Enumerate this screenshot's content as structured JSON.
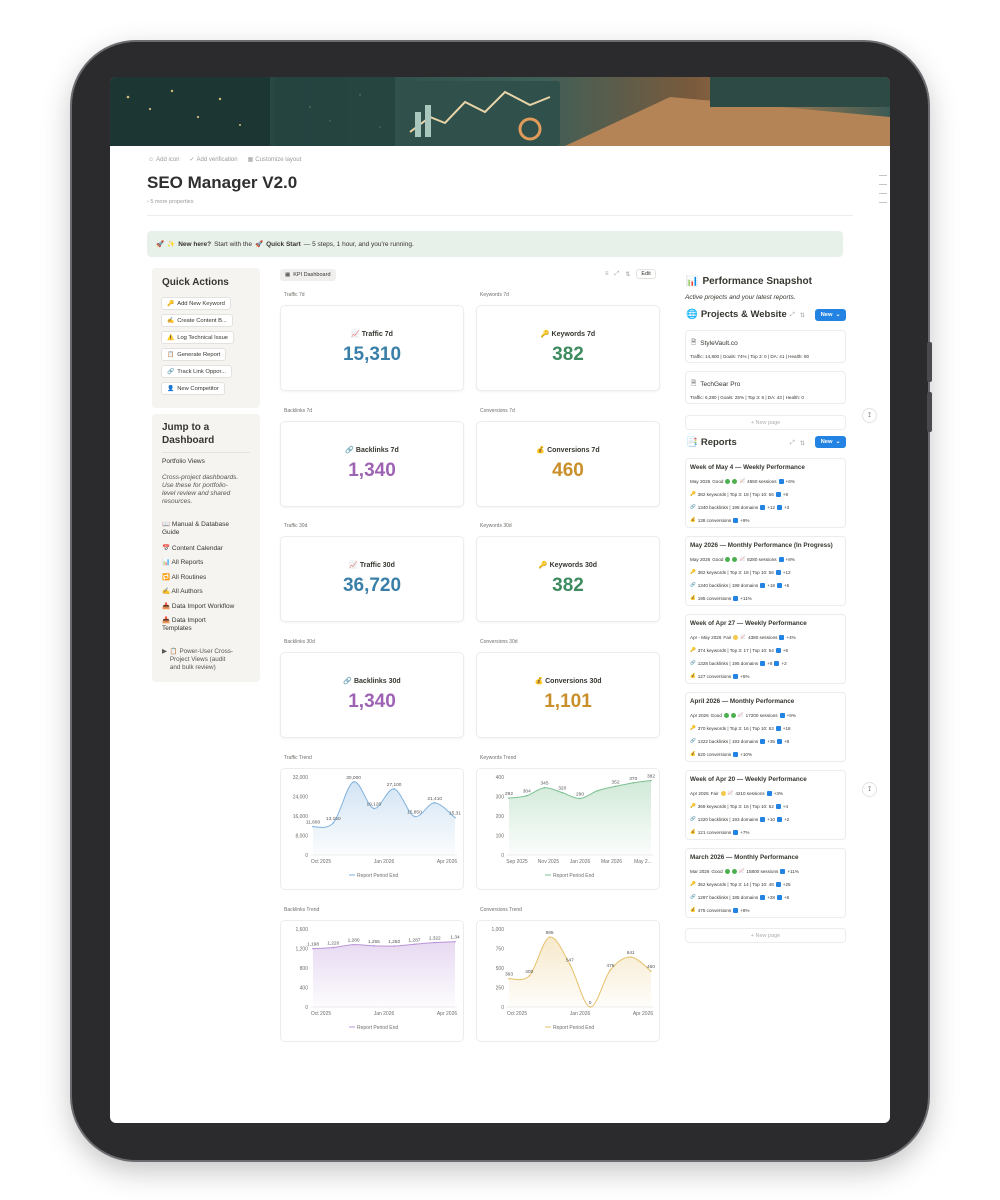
{
  "page": {
    "meta_actions": [
      "Add icon",
      "Add verification",
      "Customize layout"
    ],
    "title": "SEO Manager V2.0",
    "more_properties": "5 more properties"
  },
  "callout": {
    "icon": "🚀",
    "prefix_icon": "✨",
    "bold_intro": "New here?",
    "text_a": "Start with the",
    "qs_icon": "🚀",
    "qs_label": "Quick Start",
    "text_b": "— 5 steps, 1 hour, and you're running."
  },
  "quick_actions": {
    "title": "Quick Actions",
    "items": [
      {
        "icon": "🔑",
        "label": "Add New Keyword"
      },
      {
        "icon": "✍️",
        "label": "Create Content B..."
      },
      {
        "icon": "⚠️",
        "label": "Log Technical Issue"
      },
      {
        "icon": "📋",
        "label": "Generate Report"
      },
      {
        "icon": "🔗",
        "label": "Track Link Oppor..."
      },
      {
        "icon": "👤",
        "label": "New Competitor"
      }
    ]
  },
  "jump": {
    "title_line1": "Jump to a",
    "title_line2": "Dashboard",
    "section": "Portfolio Views",
    "description": [
      "Cross-project dashboards.",
      "Use these for portfolio-",
      "level review and shared",
      "resources."
    ],
    "links": [
      {
        "icon": "📖",
        "label": "Manual & Database",
        "label2": "Guide"
      },
      {
        "icon": "📅",
        "label": "Content Calendar"
      },
      {
        "icon": "📊",
        "label": "All Reports"
      },
      {
        "icon": "🔁",
        "label": "All Routines"
      },
      {
        "icon": "✍️",
        "label": "All Authors"
      },
      {
        "icon": "📥",
        "label": "Data Import Workflow"
      },
      {
        "icon": "📥",
        "label": "Data Import",
        "label2": "Templates"
      }
    ],
    "toggle": {
      "icon": "📋",
      "line1": "Power-User Cross-",
      "line2": "Project Views (audit",
      "line3": "and bulk review)"
    }
  },
  "kpi": {
    "tab_label": "KPI Dashboard",
    "edit_label": "Edit",
    "cards": [
      {
        "label": "Traffic 7d",
        "icon": "📈",
        "title": "Traffic 7d",
        "value": "15,310",
        "color": "#3a7fa8"
      },
      {
        "label": "Keywords 7d",
        "icon": "🔑",
        "title": "Keywords 7d",
        "value": "382",
        "color": "#3e8b5f"
      },
      {
        "label": "Backlinks 7d",
        "icon": "🔗",
        "title": "Backlinks 7d",
        "value": "1,340",
        "color": "#9d62b3"
      },
      {
        "label": "Conversions 7d",
        "icon": "💰",
        "title": "Conversions 7d",
        "value": "460",
        "color": "#c98f2a"
      },
      {
        "label": "Traffic 30d",
        "icon": "📈",
        "title": "Traffic 30d",
        "value": "36,720",
        "color": "#3a7fa8"
      },
      {
        "label": "Keywords 30d",
        "icon": "🔑",
        "title": "Keywords 30d",
        "value": "382",
        "color": "#3e8b5f"
      },
      {
        "label": "Backlinks 30d",
        "icon": "🔗",
        "title": "Backlinks 30d",
        "value": "1,340",
        "color": "#9d62b3"
      },
      {
        "label": "Conversions 30d",
        "icon": "💰",
        "title": "Conversions 30d",
        "value": "1,101",
        "color": "#c98f2a"
      }
    ]
  },
  "chart_data": [
    {
      "type": "area",
      "label": "Traffic Trend",
      "color": "#7fb2de",
      "legend": "Report Period End",
      "yticks": [
        "32,000",
        "24,000",
        "16,000",
        "8,000",
        "0"
      ],
      "ylim": [
        0,
        32000
      ],
      "xticks": [
        "Oct 2025",
        "Jan 2026",
        "Apr 2026"
      ],
      "values": [
        11600,
        13150,
        30000,
        19120,
        27100,
        15850,
        21410,
        15310
      ],
      "point_labels": [
        "11,600",
        "13,150",
        "30,000",
        "19,120",
        "27,100",
        "15,850",
        "21,410",
        "15,31"
      ]
    },
    {
      "type": "area",
      "label": "Keywords Trend",
      "color": "#7cc191",
      "legend": "Report Period End",
      "yticks": [
        "400",
        "300",
        "200",
        "100",
        "0"
      ],
      "ylim": [
        0,
        400
      ],
      "xticks": [
        "Sep 2025",
        "Nov 2025",
        "Jan 2026",
        "Mar 2026",
        "May 2..."
      ],
      "values": [
        292,
        304,
        345,
        320,
        290,
        330,
        352,
        370,
        382
      ],
      "point_labels": [
        "292",
        "304",
        "345",
        "320",
        "290",
        "",
        "352",
        "370",
        "382"
      ]
    },
    {
      "type": "area",
      "label": "Backlinks Trend",
      "color": "#bb94d8",
      "legend": "Report Period End",
      "yticks": [
        "1,600",
        "1,200",
        "800",
        "400",
        "0"
      ],
      "ylim": [
        0,
        1600
      ],
      "xticks": [
        "Oct 2025",
        "Jan 2026",
        "Apr 2026"
      ],
      "values": [
        1198,
        1220,
        1280,
        1255,
        1250,
        1287,
        1322,
        1340
      ],
      "point_labels": [
        "1,198",
        "1,220",
        "1,280",
        "1,255",
        "1,250",
        "1,287",
        "1,322",
        "1,34"
      ]
    },
    {
      "type": "area",
      "label": "Conversions Trend",
      "color": "#e6c06a",
      "legend": "Report Period End",
      "yticks": [
        "1,000",
        "750",
        "500",
        "250",
        "0"
      ],
      "ylim": [
        0,
        1000
      ],
      "xticks": [
        "Oct 2025",
        "Jan 2026",
        "Apr 2026"
      ],
      "values": [
        363,
        400,
        895,
        547,
        0,
        475,
        641,
        460
      ],
      "point_labels": [
        "363",
        "400",
        "895",
        "547",
        "0",
        "475",
        "641",
        "460"
      ]
    }
  ],
  "snapshot": {
    "title": "Performance Snapshot",
    "subtitle": "Active projects and your latest reports.",
    "projects_title": "Projects & Website",
    "new_label": "New",
    "new_page_label": "+ New page",
    "projects": [
      {
        "name": "StyleVault.co",
        "detail": "Traffic: 14,800 | Goals: 74% | Top 3: 0 | DA: 41 | Health: 80"
      },
      {
        "name": "TechGear Pro",
        "detail": "Traffic: 6,280 | Goals: 25% | Top 3: 6 | DA: 43 | Health: 0"
      }
    ],
    "reports_title": "Reports",
    "reports": [
      {
        "title": "Week of May 4 — Weekly Performance",
        "period": "May 2026",
        "health": "Good",
        "dots": [
          "#4caf50",
          "#4caf50"
        ],
        "sessions": "4650 sessions",
        "s_delta": "+6%",
        "kw": "382 keywords | Top 3: 18 | Top 10: 56",
        "kw_delta": "+8",
        "bl": "1340 backlinks | 198 domains",
        "bl_d1": "+12",
        "bl_d2": "+3",
        "conv": "138 conversions",
        "conv_delta": "+9%"
      },
      {
        "title": "May 2026 — Monthly Performance (In Progress)",
        "period": "May 2026",
        "health": "Good",
        "dots": [
          "#4caf50",
          "#4caf50"
        ],
        "sessions": "8280 sessions",
        "s_delta": "+8%",
        "kw": "382 keywords | Top 3: 18 | Top 10: 56",
        "kw_delta": "+12",
        "bl": "1340 backlinks | 198 domains",
        "bl_d1": "+18",
        "bl_d2": "+5",
        "conv": "195 conversions",
        "conv_delta": "+11%"
      },
      {
        "title": "Week of Apr 27 — Weekly Performance",
        "period": "Apr - May 2026",
        "health": "Fair",
        "dots": [
          "#f2c94c"
        ],
        "sessions": "4380 sessions",
        "s_delta": "+4%",
        "kw": "374 keywords | Top 3: 17 | Top 10: 54",
        "kw_delta": "+6",
        "bl": "1328 backlinks | 195 domains",
        "bl_d1": "+8",
        "bl_d2": "+2",
        "conv": "127 conversions",
        "conv_delta": "+5%"
      },
      {
        "title": "April 2026 — Monthly Performance",
        "period": "Apr 2026",
        "health": "Good",
        "dots": [
          "#4caf50",
          "#4caf50"
        ],
        "sessions": "17200 sessions",
        "s_delta": "+9%",
        "kw": "370 keywords | Top 3: 16 | Top 10: 53",
        "kw_delta": "+18",
        "bl": "1322 backlinks | 193 domains",
        "bl_d1": "+35",
        "bl_d2": "+8",
        "conv": "520 conversions",
        "conv_delta": "+10%"
      },
      {
        "title": "Week of Apr 20 — Weekly Performance",
        "period": "Apr 2026",
        "health": "Fair",
        "dots": [
          "#f2c94c"
        ],
        "sessions": "4210 sessions",
        "s_delta": "+3%",
        "kw": "368 keywords | Top 3: 16 | Top 10: 52",
        "kw_delta": "+4",
        "bl": "1320 backlinks | 193 domains",
        "bl_d1": "+10",
        "bl_d2": "+2",
        "conv": "121 conversions",
        "conv_delta": "+7%"
      },
      {
        "title": "March 2026 — Monthly Performance",
        "period": "Mar 2026",
        "health": "Good",
        "dots": [
          "#4caf50",
          "#4caf50"
        ],
        "sessions": "15800 sessions",
        "s_delta": "+11%",
        "kw": "352 keywords | Top 3: 14 | Top 10: 48",
        "kw_delta": "+25",
        "bl": "1287 backlinks | 185 domains",
        "bl_d1": "+28",
        "bl_d2": "+6",
        "conv": "475 conversions",
        "conv_delta": "+8%"
      }
    ]
  }
}
